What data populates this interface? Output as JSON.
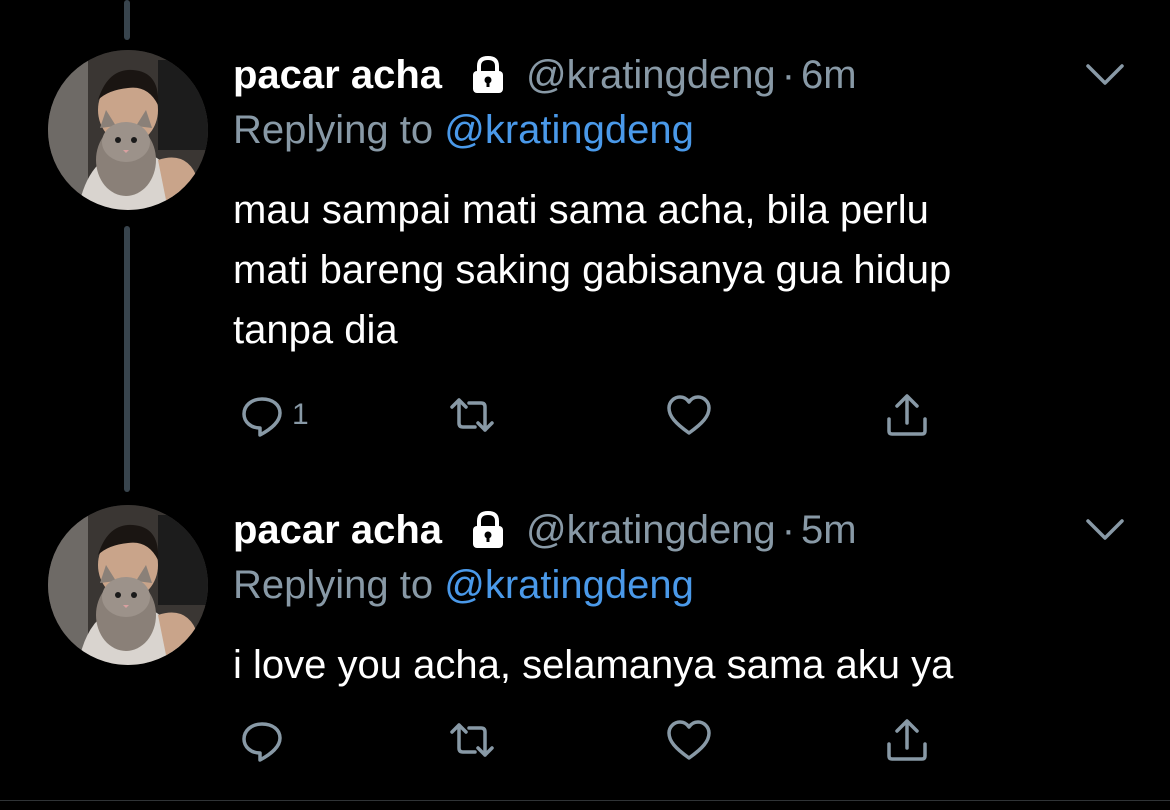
{
  "colors": {
    "background": "#000000",
    "primary_text": "#ffffff",
    "secondary_text": "#8899a6",
    "mention": "#4a99e9",
    "thread_line": "#38444d"
  },
  "tweets": [
    {
      "display_name": "pacar acha",
      "handle": "@kratingdeng",
      "separator": "·",
      "time": "6m",
      "replying_prefix": "Replying to ",
      "replying_to": "@kratingdeng",
      "text_lines": [
        "mau sampai mati sama acha, bila perlu",
        "mati bareng saking gabisanya gua hidup",
        "tanpa dia"
      ],
      "reply_count": "1",
      "icons": [
        "lock-icon",
        "chevron-down-icon",
        "reply-icon",
        "retweet-icon",
        "like-icon",
        "share-icon"
      ]
    },
    {
      "display_name": "pacar acha",
      "handle": "@kratingdeng",
      "separator": "·",
      "time": "5m",
      "replying_prefix": "Replying to ",
      "replying_to": "@kratingdeng",
      "text_lines": [
        "i love you acha, selamanya sama aku ya"
      ],
      "reply_count": "",
      "icons": [
        "lock-icon",
        "chevron-down-icon",
        "reply-icon",
        "retweet-icon",
        "like-icon",
        "share-icon"
      ]
    }
  ]
}
